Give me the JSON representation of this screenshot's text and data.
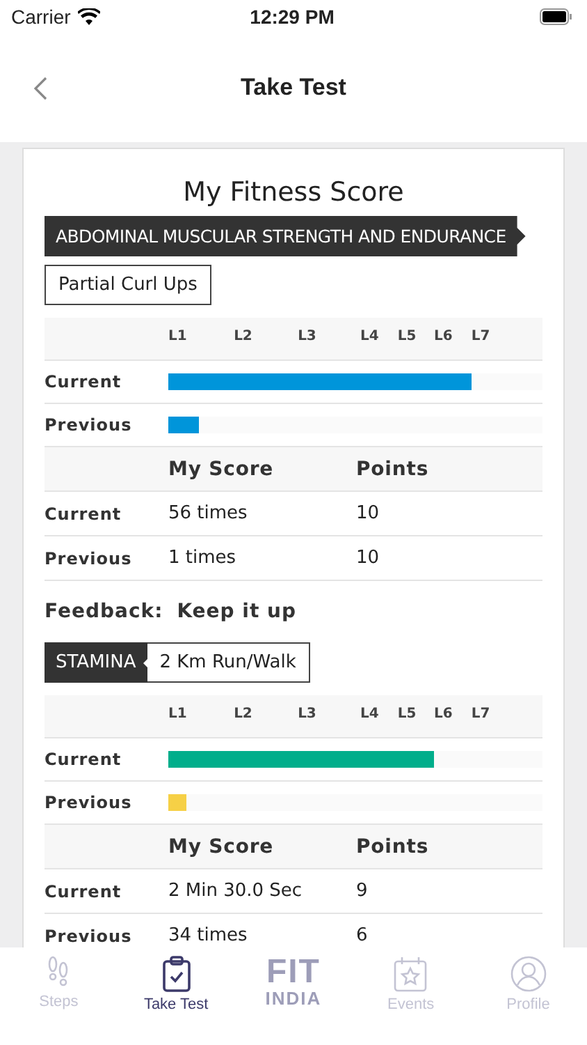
{
  "status_bar": {
    "carrier": "Carrier",
    "time": "12:29 PM"
  },
  "nav": {
    "title": "Take Test"
  },
  "card": {
    "title": "My Fitness Score",
    "sections": [
      {
        "kind": "banner",
        "category": "ABDOMINAL MUSCULAR STRENGTH AND ENDURANCE",
        "test": "Partial Curl Ups",
        "levels": [
          "L1",
          "L2",
          "L3",
          "L4",
          "L5",
          "L6",
          "L7"
        ],
        "bars": [
          {
            "label": "Current",
            "level": 0.81,
            "color": "#0095da"
          },
          {
            "label": "Previous",
            "level": 0.08,
            "color": "#0095da"
          }
        ],
        "score_header": [
          "My Score",
          "Points"
        ],
        "scores": [
          {
            "label": "Current",
            "score": "56 times",
            "points": "10"
          },
          {
            "label": "Previous",
            "score": "1 times",
            "points": "10"
          }
        ],
        "feedback": {
          "label": "Feedback:",
          "text": "Keep it up"
        }
      },
      {
        "kind": "inline",
        "category": "STAMINA",
        "test": "2 Km Run/Walk",
        "levels": [
          "L1",
          "L2",
          "L3",
          "L4",
          "L5",
          "L6",
          "L7"
        ],
        "bars": [
          {
            "label": "Current",
            "level": 0.71,
            "color": "#00ae8b"
          },
          {
            "label": "Previous",
            "level": 0.05,
            "color": "#f6d046"
          }
        ],
        "score_header": [
          "My Score",
          "Points"
        ],
        "scores": [
          {
            "label": "Current",
            "score": "2 Min 30.0 Sec",
            "points": "9"
          },
          {
            "label": "Previous",
            "score": "34 times",
            "points": "6"
          }
        ]
      }
    ]
  },
  "tab_bar": {
    "items": [
      {
        "kind": "steps",
        "label": "Steps",
        "selected": false
      },
      {
        "kind": "clipboard",
        "label": "Take Test",
        "selected": true
      },
      {
        "kind": "logo",
        "logo_text": "FIT",
        "label": "INDIA",
        "selected": false
      },
      {
        "kind": "calendar",
        "label": "Events",
        "selected": false
      },
      {
        "kind": "profile",
        "label": "Profile",
        "selected": false
      }
    ]
  }
}
